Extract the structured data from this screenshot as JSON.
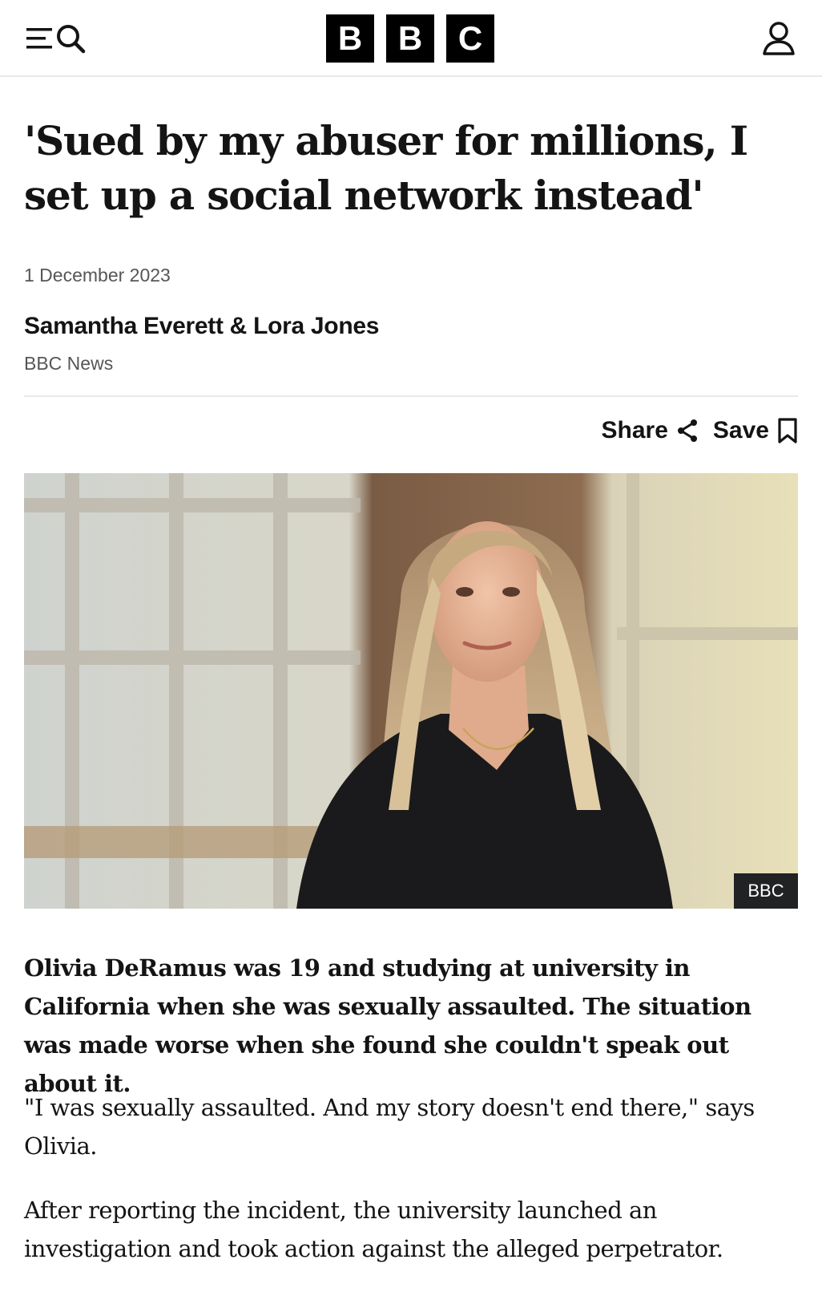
{
  "header": {
    "logo_letters": [
      "B",
      "B",
      "C"
    ],
    "icons": {
      "menu": "menu-icon",
      "search": "search-icon",
      "account": "account-icon"
    }
  },
  "article": {
    "headline": "'Sued by my abuser for millions, I set up a social network instead'",
    "date": "1 December 2023",
    "byline": "Samantha Everett & Lora Jones",
    "byline_org": "BBC News",
    "actions": {
      "share_label": "Share",
      "save_label": "Save"
    },
    "image": {
      "credit": "BBC"
    },
    "lede": "Olivia DeRamus was 19 and studying at university in California when she was sexually assaulted. The situation was made worse when she found she couldn't speak out about it.",
    "paragraphs": [
      "\"I was sexually assaulted. And my story doesn't end there,\" says Olivia.",
      "After reporting the incident, the university launched an investigation and took action against the alleged perpetrator."
    ]
  },
  "colors": {
    "text": "#141414",
    "muted": "#545658",
    "divider": "#e6e8ea",
    "logo_bg": "#000000",
    "credit_bg": "#202224"
  }
}
